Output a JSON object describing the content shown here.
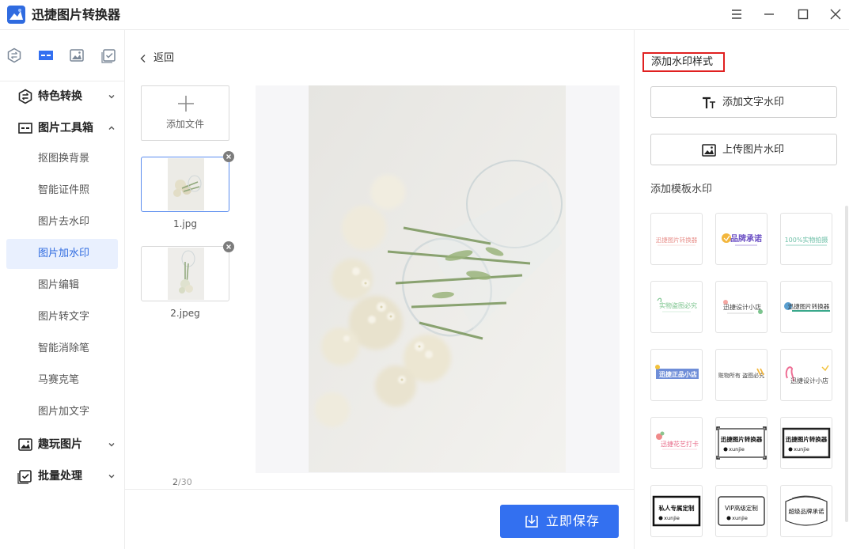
{
  "app": {
    "title": "迅捷图片转换器"
  },
  "sidebar": {
    "groups": [
      {
        "label": "特色转换"
      },
      {
        "label": "图片工具箱"
      },
      {
        "label": "趣玩图片"
      },
      {
        "label": "批量处理"
      }
    ],
    "toolbox_items": [
      {
        "label": "抠图换背景"
      },
      {
        "label": "智能证件照"
      },
      {
        "label": "图片去水印"
      },
      {
        "label": "图片加水印"
      },
      {
        "label": "图片编辑"
      },
      {
        "label": "图片转文字"
      },
      {
        "label": "智能消除笔"
      },
      {
        "label": "马赛克笔"
      },
      {
        "label": "图片加文字"
      }
    ],
    "active_item": "图片加水印"
  },
  "files": {
    "back_label": "返回",
    "add_label": "添加文件",
    "items": [
      {
        "name": "1.jpg",
        "selected": true
      },
      {
        "name": "2.jpeg",
        "selected": false
      }
    ],
    "count_current": "2",
    "count_total": "/30"
  },
  "actions": {
    "save_label": "立即保存"
  },
  "watermark": {
    "title": "添加水印样式",
    "text_button": "添加文字水印",
    "image_button": "上传图片水印",
    "template_section": "添加模板水印",
    "templates": [
      {
        "text": "迅捷图片转换器"
      },
      {
        "text": "品牌承诺"
      },
      {
        "text": "100%实物拍摄"
      },
      {
        "text": "实物盗图必究"
      },
      {
        "text": "迅捷设计小店"
      },
      {
        "text": "迅捷图片转换器"
      },
      {
        "text": "迅捷正品小店"
      },
      {
        "text": "赃物所有 盗图必究"
      },
      {
        "text": "迅捷设计小店"
      },
      {
        "text": "迅捷花艺打卡"
      },
      {
        "text": "迅捷图片转换器",
        "sub": "xunjie"
      },
      {
        "text": "迅捷图片转换器",
        "sub": "xunjie"
      },
      {
        "text": "私人专属定制",
        "sub": "xunjie"
      },
      {
        "text": "VIP高级定制",
        "sub": "xunjie"
      },
      {
        "text": "超级品牌承诺"
      }
    ]
  },
  "colors": {
    "accent": "#3370f0",
    "active_bg": "#e9f0fe",
    "highlight_border": "#e02020"
  }
}
